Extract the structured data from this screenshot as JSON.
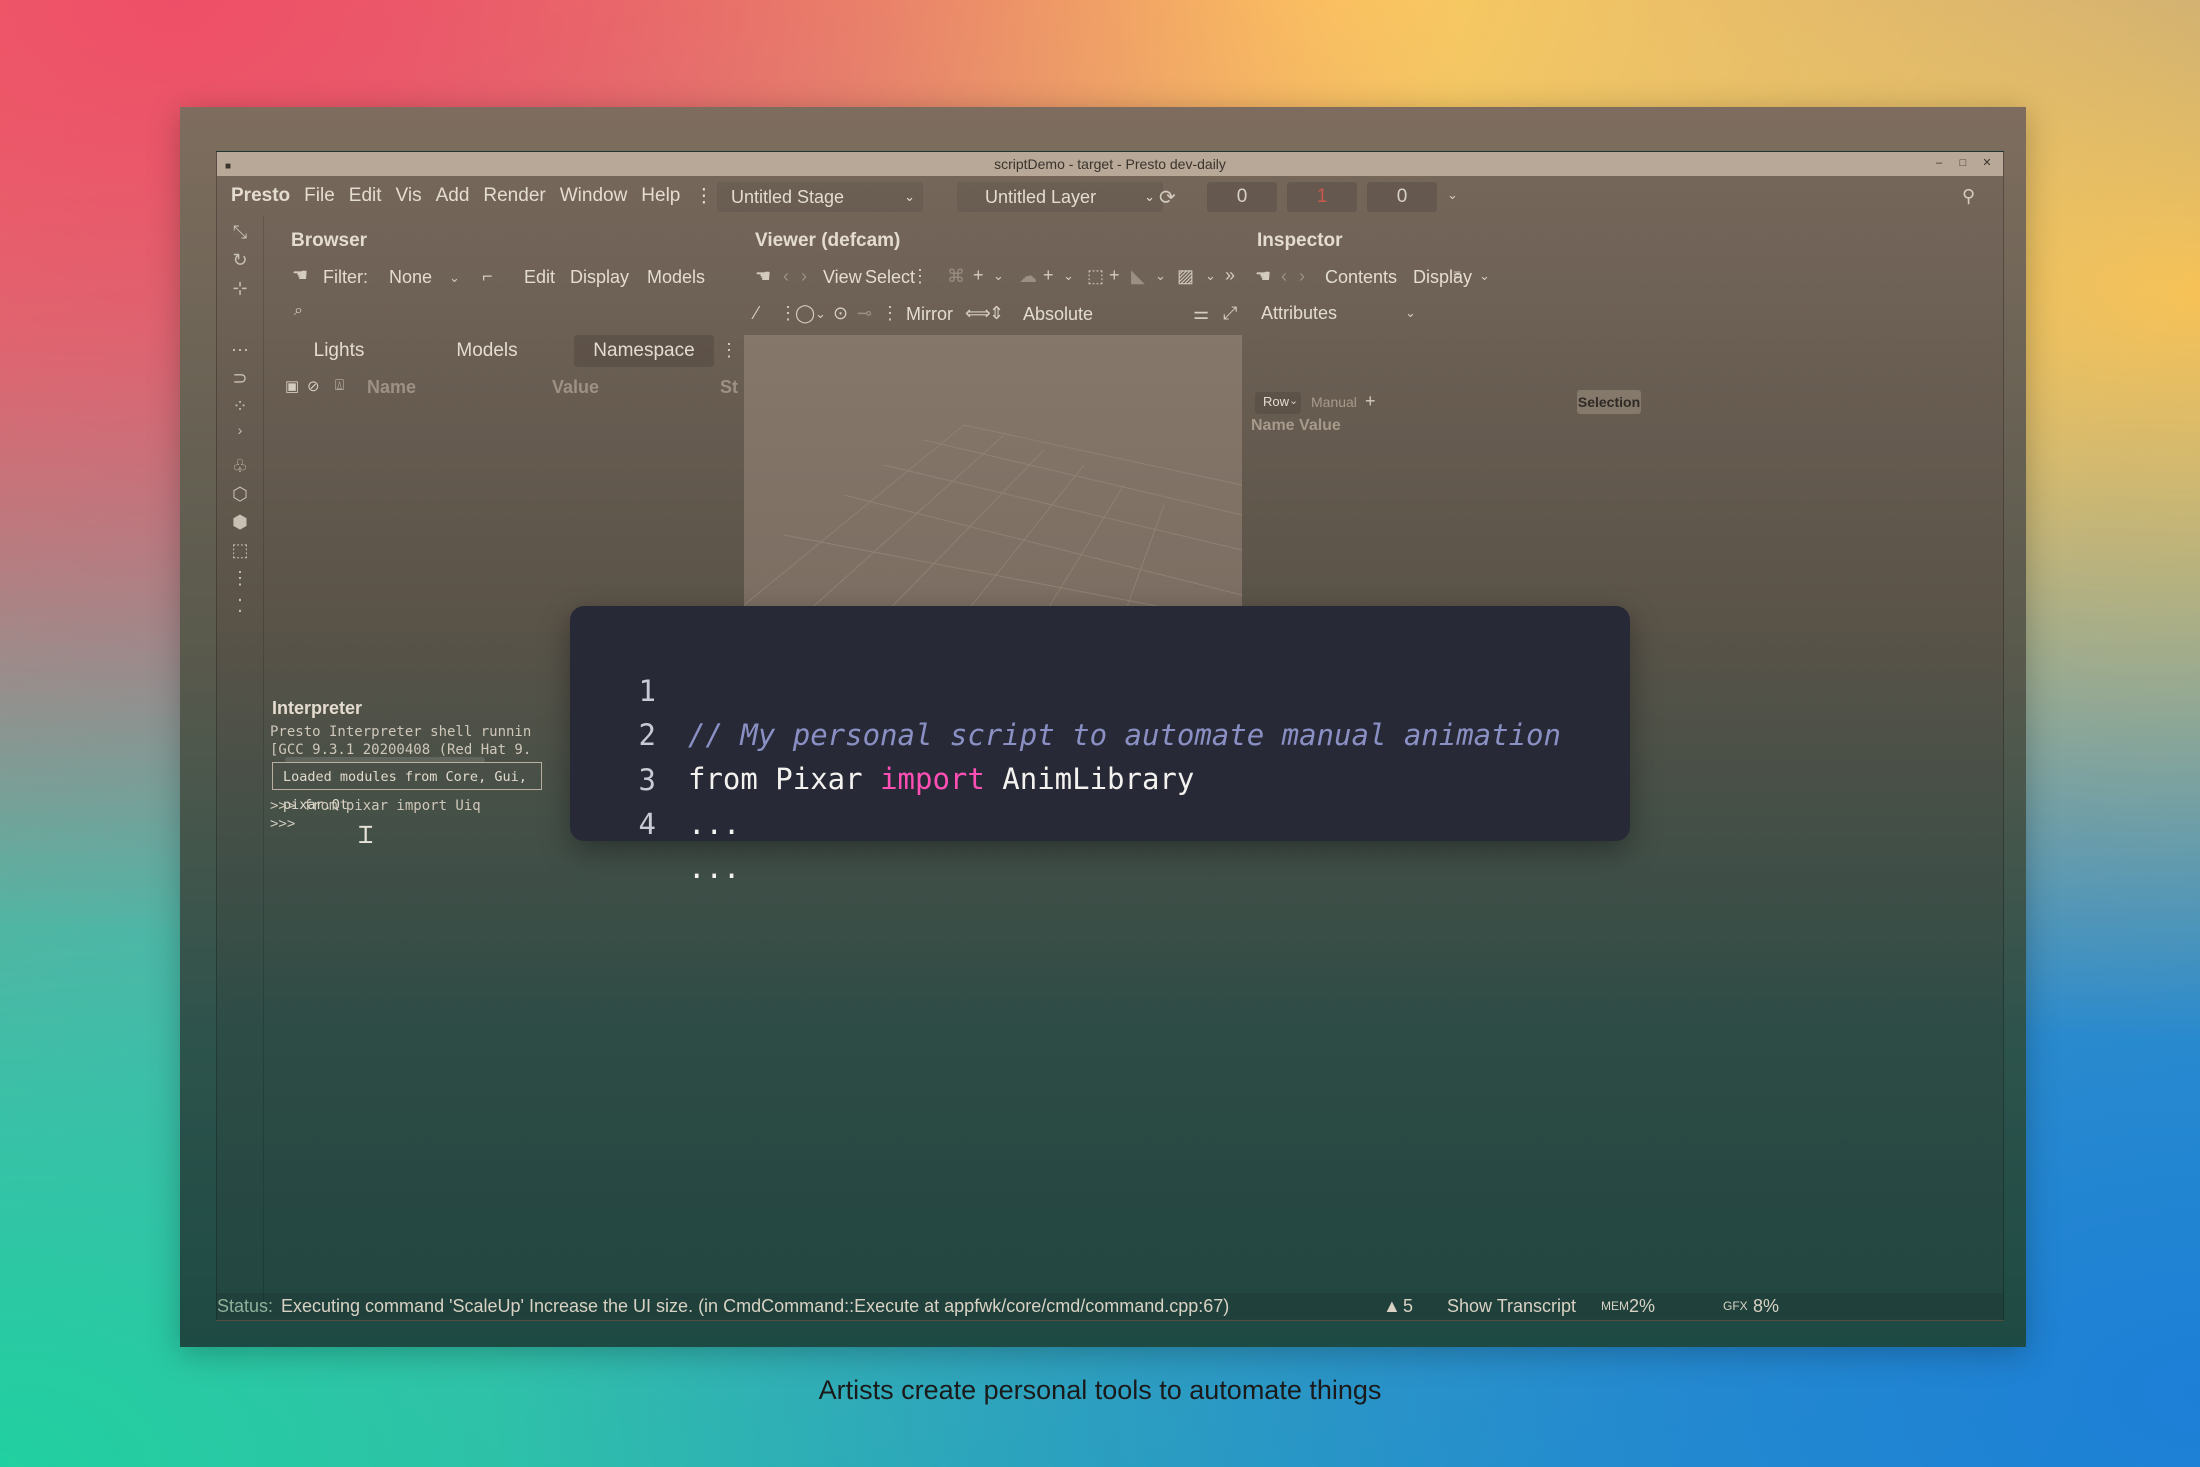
{
  "window": {
    "title": "scriptDemo - target - Presto dev-daily"
  },
  "menu": {
    "brand": "Presto",
    "items": [
      "File",
      "Edit",
      "Vis",
      "Add",
      "Render",
      "Window",
      "Help"
    ],
    "stage": "Untitled Stage",
    "layer": "Untitled Layer",
    "frame_start": "0",
    "frame_current": "1",
    "frame_end": "0"
  },
  "browser": {
    "title": "Browser",
    "filter_label": "Filter:",
    "filter_value": "None",
    "edit": "Edit",
    "display": "Display",
    "models": "Models",
    "tabs": [
      "Lights",
      "Models",
      "Namespace"
    ],
    "columns": {
      "name": "Name",
      "value": "Value",
      "status": "St"
    }
  },
  "viewer": {
    "title": "Viewer (defcam)",
    "view": "View",
    "select": "Select",
    "mirror": "Mirror",
    "absolute": "Absolute"
  },
  "inspector": {
    "title": "Inspector",
    "contents": "Contents",
    "display": "Display",
    "mode": "Attributes",
    "row": "Row",
    "manual": "Manual",
    "selection": "Selection",
    "columns": "Name Value"
  },
  "interpreter": {
    "title": "Interpreter",
    "lines": [
      "Presto Interpreter shell runnin",
      "[GCC 9.3.1 20200408 (Red Hat 9."
    ],
    "loaded": "Loaded modules from Core, Gui, pixar.Qt",
    "cmd1": ">>> from pixar import Uiq",
    "cmd2": ">>>"
  },
  "status": {
    "label": "Status:",
    "message": "Executing command 'ScaleUp' Increase the UI size. (in CmdCommand::Execute at appfwk/core/cmd/command.cpp:67)",
    "warnings": "5",
    "transcript": "Show Transcript",
    "mem_label": "MEM",
    "mem_value": "2%",
    "gfx_label": "GFX",
    "gfx_value": "8%"
  },
  "code": {
    "lines": [
      {
        "n": "1",
        "text": "// My personal script to automate manual animation"
      },
      {
        "n": "2",
        "a": "from Pixar ",
        "kw": "import",
        "b": " AnimLibrary"
      },
      {
        "n": "3",
        "text": "..."
      },
      {
        "n": "4",
        "text": "..."
      }
    ]
  },
  "caption": "Artists create personal tools to automate things"
}
